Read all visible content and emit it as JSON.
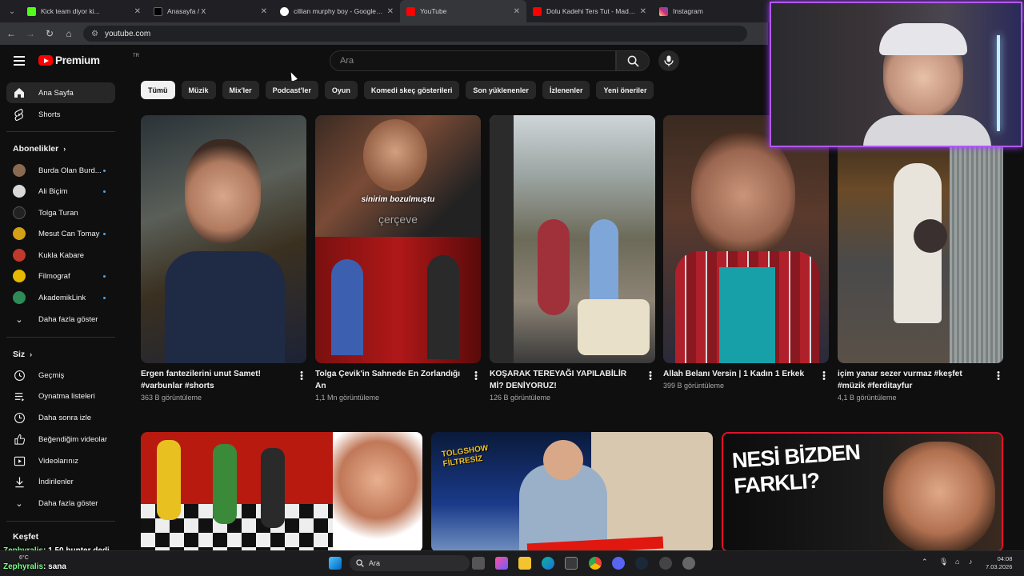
{
  "browser": {
    "tabs": [
      {
        "title": "Kick team diyor ki...",
        "favicon_color": "#53fc18",
        "active": false
      },
      {
        "title": "Anasayfa / X",
        "favicon_color": "#000000",
        "active": false
      },
      {
        "title": "cillian murphy boy - Google'da Ara",
        "favicon_color": "#4285f4",
        "active": false
      },
      {
        "title": "YouTube",
        "favicon_color": "#ff0000",
        "active": true
      },
      {
        "title": "Dolu Kadehi Ters Tut - Madem",
        "favicon_color": "#ff0000",
        "active": false
      },
      {
        "title": "Instagram",
        "favicon_color": "#e1306c",
        "active": false
      }
    ],
    "url": "youtube.com"
  },
  "youtube": {
    "logo_text": "Premium",
    "logo_region": "TR",
    "search_placeholder": "Ara",
    "sidebar": {
      "main": [
        {
          "label": "Ana Sayfa",
          "icon": "home-icon",
          "active": true
        },
        {
          "label": "Shorts",
          "icon": "shorts-icon",
          "active": false
        }
      ],
      "subscriptions_title": "Abonelikler",
      "subscriptions": [
        {
          "label": "Burda Olan Burd...",
          "avatar_color": "#8a6a50",
          "dot": true
        },
        {
          "label": "Ali Biçim",
          "avatar_color": "#d9d9d9",
          "dot": true
        },
        {
          "label": "Tolga Turan",
          "avatar_color": "#222222",
          "dot": false
        },
        {
          "label": "Mesut Can Tomay",
          "avatar_color": "#d4a017",
          "dot": true
        },
        {
          "label": "Kukla Kabare",
          "avatar_color": "#c0392b",
          "dot": false
        },
        {
          "label": "Filmograf",
          "avatar_color": "#e6b800",
          "dot": true
        },
        {
          "label": "AkademikLink",
          "avatar_color": "#2e8b57",
          "dot": true
        }
      ],
      "show_more_1": "Daha fazla göster",
      "you_title": "Siz",
      "you_items": [
        {
          "label": "Geçmiş",
          "icon": "history-icon"
        },
        {
          "label": "Oynatma listeleri",
          "icon": "playlist-icon"
        },
        {
          "label": "Daha sonra izle",
          "icon": "watch-later-icon"
        },
        {
          "label": "Beğendiğim videolar",
          "icon": "like-icon"
        },
        {
          "label": "Videolarınız",
          "icon": "your-videos-icon"
        },
        {
          "label": "İndirilenler",
          "icon": "download-icon"
        }
      ],
      "show_more_2": "Daha fazla göster",
      "explore_title": "Keşfet"
    },
    "chips": [
      "Tümü",
      "Müzik",
      "Mix'ler",
      "Podcast'ler",
      "Oyun",
      "Komedi skeç gösterileri",
      "Son yüklenenler",
      "İzlenenler",
      "Yeni öneriler"
    ],
    "shorts": [
      {
        "title": "Ergen fantezilerini unut Samet! #varbunlar #shorts",
        "views": "363 B görüntüleme",
        "overlay1": "",
        "overlay2": ""
      },
      {
        "title": "Tolga Çevik'in Sahnede En Zorlandığı An",
        "views": "1,1 Mn görüntüleme",
        "overlay1": "sinirim bozulmuştu",
        "overlay2": "çerçeve"
      },
      {
        "title": "KOŞARAK TEREYAĞI YAPILABİLİR Mİ? DENİYORUZ!",
        "views": "126 B görüntüleme",
        "overlay1": "",
        "overlay2": ""
      },
      {
        "title": "Allah Belanı Versin | 1 Kadın 1 Erkek",
        "views": "399 B görüntüleme",
        "overlay1": "",
        "overlay2": ""
      },
      {
        "title": "içim yanar sezer vurmaz #keşfet #müzik #ferditayfur",
        "views": "4,1 B görüntüleme",
        "overlay1": "",
        "overlay2": ""
      }
    ],
    "videos": [
      {
        "thumb_text": ""
      },
      {
        "thumb_text": "TOLGSHOW FİLTRESİZ"
      },
      {
        "thumb_text": "NESİ BİZDEN FARKLI?"
      }
    ]
  },
  "overlay": {
    "chat": [
      {
        "name": "Zephyralis",
        "message": ": 1.50 hunter dedi"
      },
      {
        "name": "Zephyralis",
        "message": ": sana"
      }
    ]
  },
  "taskbar": {
    "search_label": "Ara",
    "weather": "6°C",
    "time": "04:08",
    "date": "7.03.2026"
  }
}
